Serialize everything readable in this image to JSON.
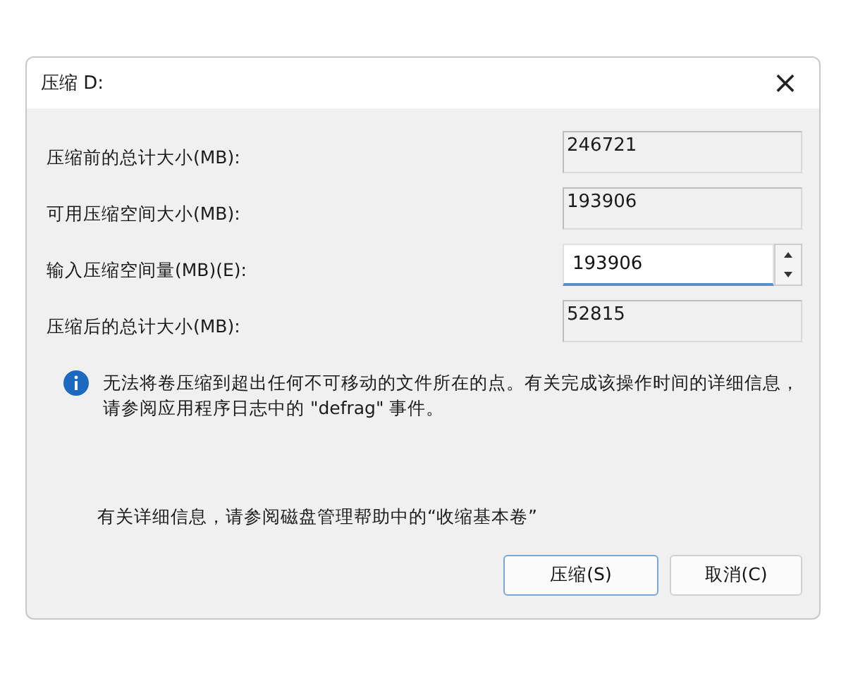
{
  "window": {
    "title": "压缩 D:",
    "close": "×"
  },
  "fields": [
    {
      "label": "压缩前的总计大小(MB):",
      "value": "246721",
      "kind": "readonly"
    },
    {
      "label": "可用压缩空间大小(MB):",
      "value": "193906",
      "kind": "readonly"
    },
    {
      "label": "输入压缩空间量(MB)(E):",
      "value": "193906",
      "kind": "spin"
    },
    {
      "label": "压缩后的总计大小(MB):",
      "value": "52815",
      "kind": "readonly"
    }
  ],
  "info": "无法将卷压缩到超出任何不可移动的文件所在的点。有关完成该操作时间的详细信息，请参阅应用程序日志中的 \"defrag\" 事件。",
  "help": "有关详细信息，请参阅磁盘管理帮助中的“收缩基本卷”",
  "buttons": [
    {
      "label": "压缩(S)",
      "default": true
    },
    {
      "label": "取消(C)",
      "default": false
    }
  ]
}
